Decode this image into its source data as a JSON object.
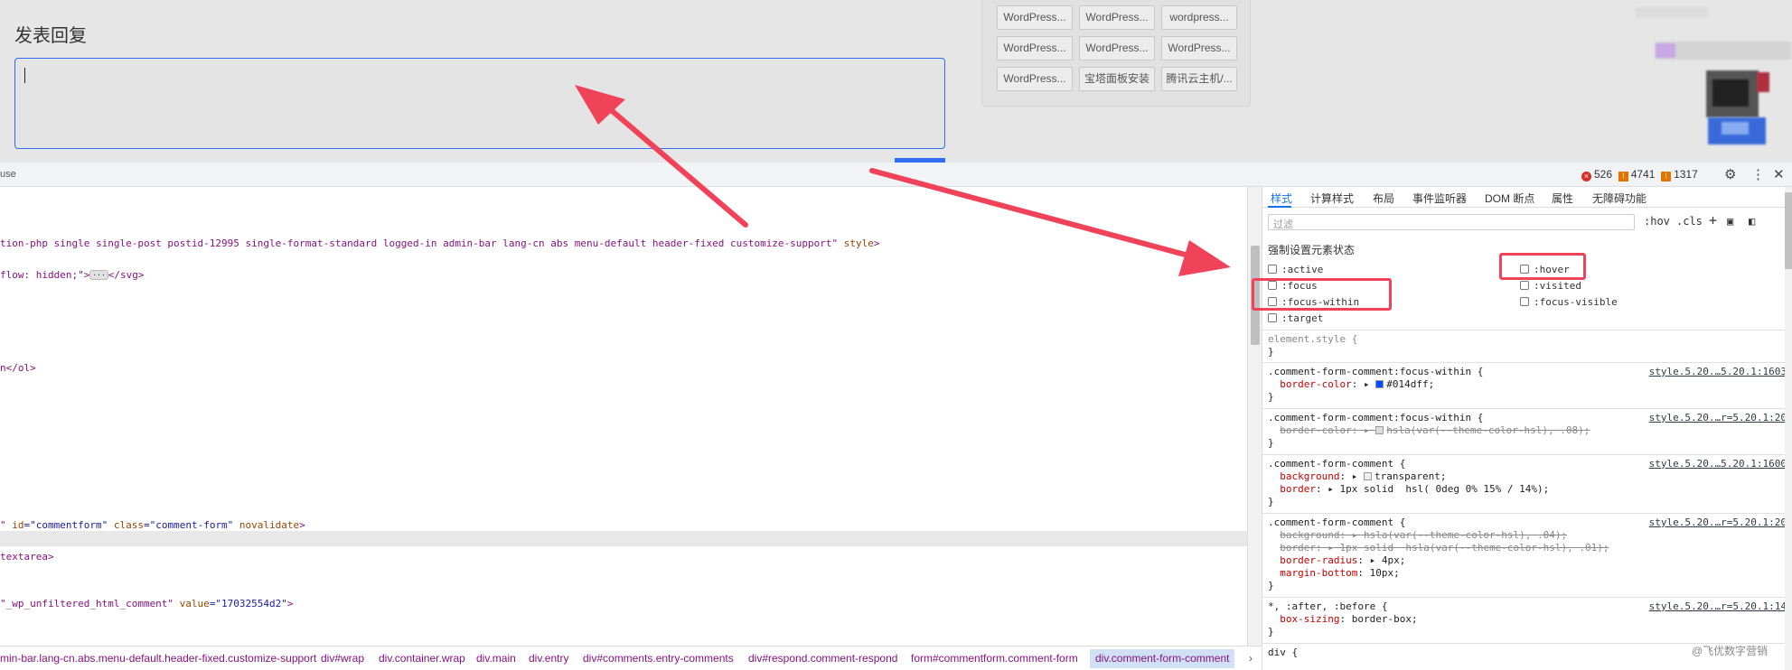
{
  "page": {
    "title": "发表回复",
    "tags": [
      "WordPress...",
      "WordPress...",
      "wordpress...",
      "WordPress...",
      "WordPress...",
      "WordPress...",
      "WordPress...",
      "宝塔面板安装",
      "腾讯云主机/..."
    ]
  },
  "devtools": {
    "tab_text": "use",
    "errors": "526",
    "warnings": "4741",
    "issues": "1317",
    "settings_icon": "gear-icon",
    "more_icon": "kebab-icon",
    "close_icon": "close-icon"
  },
  "elements": {
    "lines": [
      {
        "pre": "tion-php single single-post postid-12995 single-format-standard logged-in admin-bar lang-cn abs menu-default header-fixed customize-support\"",
        "attr": " style",
        "tail": ">"
      },
      {
        "pre": "flow: hidden;\">",
        "dots": "···",
        "tail": "</svg>"
      },
      {
        "pre": "n</ol>"
      },
      {
        "pre": "\"",
        "attr": " id",
        "val": "=\"commentform\"",
        "attr2": " class",
        "val2": "=\"comment-form\"",
        "attr3": " novalidate",
        "tail": ">"
      },
      {
        "pre": "textarea>"
      },
      {
        "pre": "\"_wp_unfiltered_html_comment\"",
        "attr": " value",
        "val": "=\"17032554d2\"",
        "tail": ">"
      }
    ]
  },
  "breadcrumbs": [
    "min-bar.lang-cn.abs.menu-default.header-fixed.customize-support",
    "div#wrap",
    "div.container.wrap",
    "div.main",
    "div.entry",
    "div#comments.entry-comments",
    "div#respond.comment-respond",
    "form#commentform.comment-form",
    "div.comment-form-comment"
  ],
  "styles_panel": {
    "tabs": [
      "样式",
      "计算样式",
      "布局",
      "事件监听器",
      "DOM 断点",
      "属性",
      "无障碍功能"
    ],
    "filter_placeholder": "过滤",
    "hov": ":hov",
    "cls": ".cls",
    "force_title": "强制设置元素状态",
    "states_left": [
      ":active",
      ":focus",
      ":focus-within",
      ":target"
    ],
    "states_right": [
      ":hover",
      ":visited",
      ":focus-visible"
    ],
    "rules": [
      {
        "selector": "element.style {",
        "source": "",
        "lines": [],
        "close": "}"
      },
      {
        "selector": ".comment-form-comment:focus-within {",
        "source": "style.5.20.…5.20.1:1603",
        "lines": [
          {
            "prop": "border-color",
            "value": "#014dff",
            "swatch": "#014dff"
          }
        ],
        "close": "}"
      },
      {
        "selector": ".comment-form-comment:focus-within {",
        "source": "style.5.20.…r=5.20.1:20",
        "lines": [
          {
            "prop": "border-color",
            "value": "hsla(var(--theme-color-hsl), .08);",
            "strike": true
          }
        ],
        "close": "}"
      },
      {
        "selector": ".comment-form-comment {",
        "source": "style.5.20.…5.20.1:1600",
        "lines": [
          {
            "prop": "background",
            "value": "transparent;"
          },
          {
            "prop": "border",
            "value": "1px solid  hsl( 0deg 0% 15% / 14%);"
          }
        ],
        "close": "}"
      },
      {
        "selector": ".comment-form-comment {",
        "source": "style.5.20.…r=5.20.1:20",
        "lines": [
          {
            "prop": "background",
            "value": "hsla(var(--theme-color-hsl), .04);",
            "strike": true
          },
          {
            "prop": "border",
            "value": "1px solid  hsla(var(--theme-color-hsl), .01);",
            "strike": true
          },
          {
            "prop": "border-radius",
            "value": "4px;"
          },
          {
            "prop": "margin-bottom",
            "value": "10px;"
          }
        ],
        "close": "}"
      },
      {
        "selector": "*, :after, :before {",
        "source": "style.5.20.…r=5.20.1:14",
        "lines": [
          {
            "prop": "box-sizing",
            "value": "border-box;"
          }
        ],
        "close": "}"
      },
      {
        "selector": "div {",
        "source": "",
        "lines": [],
        "close": ""
      }
    ]
  },
  "watermark": "@飞优数字营销",
  "colors": {
    "accent": "#1a73e8",
    "annotation": "#f0435a",
    "focus_border": "#2f6df2"
  }
}
